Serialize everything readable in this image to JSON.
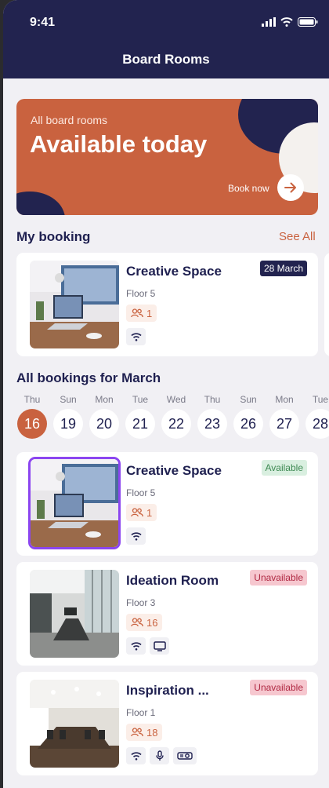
{
  "status_bar": {
    "time": "9:41"
  },
  "header": {
    "title": "Board Rooms"
  },
  "banner": {
    "subtitle": "All board rooms",
    "title": "Available today",
    "cta_label": "Book now"
  },
  "my_booking": {
    "title": "My booking",
    "see_all": "See All",
    "card": {
      "name": "Creative Space",
      "floor": "Floor 5",
      "capacity": "1",
      "date_badge": "28 March",
      "amenities": [
        "wifi-icon"
      ]
    }
  },
  "calendar": {
    "title": "All bookings for March",
    "days": [
      {
        "day": "Thu",
        "date": "16",
        "active": true
      },
      {
        "day": "Sun",
        "date": "19"
      },
      {
        "day": "Mon",
        "date": "20"
      },
      {
        "day": "Tue",
        "date": "21"
      },
      {
        "day": "Wed",
        "date": "22"
      },
      {
        "day": "Thu",
        "date": "23"
      },
      {
        "day": "Sun",
        "date": "26"
      },
      {
        "day": "Mon",
        "date": "27"
      },
      {
        "day": "Tue",
        "date": "28"
      }
    ]
  },
  "rooms": [
    {
      "name": "Creative Space",
      "floor": "Floor 5",
      "capacity": "1",
      "status": "Available",
      "amenities": [
        "wifi-icon"
      ]
    },
    {
      "name": "Ideation Room",
      "floor": "Floor 3",
      "capacity": "16",
      "status": "Unavailable",
      "amenities": [
        "wifi-icon",
        "monitor-icon"
      ]
    },
    {
      "name": "Inspiration ...",
      "floor": "Floor 1",
      "capacity": "18",
      "status": "Unavailable",
      "amenities": [
        "wifi-icon",
        "microphone-icon",
        "projector-icon"
      ]
    }
  ],
  "colors": {
    "primary": "#22234f",
    "accent": "#c9623f",
    "selected_border": "#8b45f0",
    "available_bg": "#d9efe0",
    "unavailable_bg": "#f6c7cf"
  }
}
